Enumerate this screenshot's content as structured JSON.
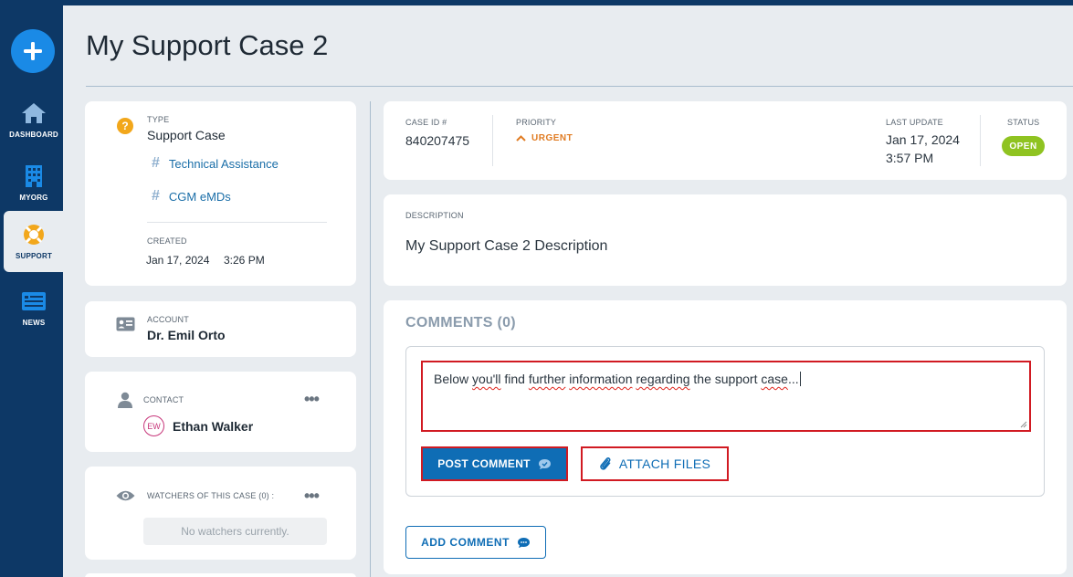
{
  "sidebar": {
    "items": [
      {
        "label": "DASHBOARD",
        "icon": "home-icon"
      },
      {
        "label": "MYORG",
        "icon": "building-icon"
      },
      {
        "label": "SUPPORT",
        "icon": "lifebuoy-icon"
      },
      {
        "label": "NEWS",
        "icon": "newspaper-icon"
      }
    ],
    "active": "SUPPORT"
  },
  "page": {
    "title": "My Support Case 2"
  },
  "type_card": {
    "type_label": "TYPE",
    "type_value": "Support Case",
    "tags": [
      "Technical Assistance",
      "CGM eMDs"
    ],
    "created_label": "CREATED",
    "created_date": "Jan 17, 2024",
    "created_time": "3:26 PM"
  },
  "account_card": {
    "label": "ACCOUNT",
    "value": "Dr. Emil Orto"
  },
  "contact_card": {
    "label": "CONTACT",
    "initials": "EW",
    "name": "Ethan Walker"
  },
  "watchers_card": {
    "label": "WATCHERS OF THIS CASE (0) :",
    "empty_text": "No watchers currently."
  },
  "case_info": {
    "case_id_label": "CASE ID #",
    "case_id": "840207475",
    "priority_label": "PRIORITY",
    "priority": "URGENT",
    "last_update_label": "LAST UPDATE",
    "last_update_date": "Jan 17, 2024",
    "last_update_time": "3:57 PM",
    "status_label": "STATUS",
    "status": "OPEN"
  },
  "description": {
    "label": "DESCRIPTION",
    "text": "My Support Case 2 Description"
  },
  "comments": {
    "title": "COMMENTS (0)",
    "draft_parts": [
      "Below ",
      "you'll",
      " find ",
      "further",
      " ",
      "information",
      " ",
      "regarding",
      " the support ",
      "case",
      "..."
    ],
    "post_label": "POST COMMENT",
    "attach_label": "ATTACH FILES",
    "add_label": "ADD COMMENT"
  },
  "colors": {
    "sidebar": "#0d3866",
    "accent": "#0f6db5",
    "urgent": "#e07b22",
    "status_open": "#8fc321",
    "highlight_border": "#d11a22"
  }
}
